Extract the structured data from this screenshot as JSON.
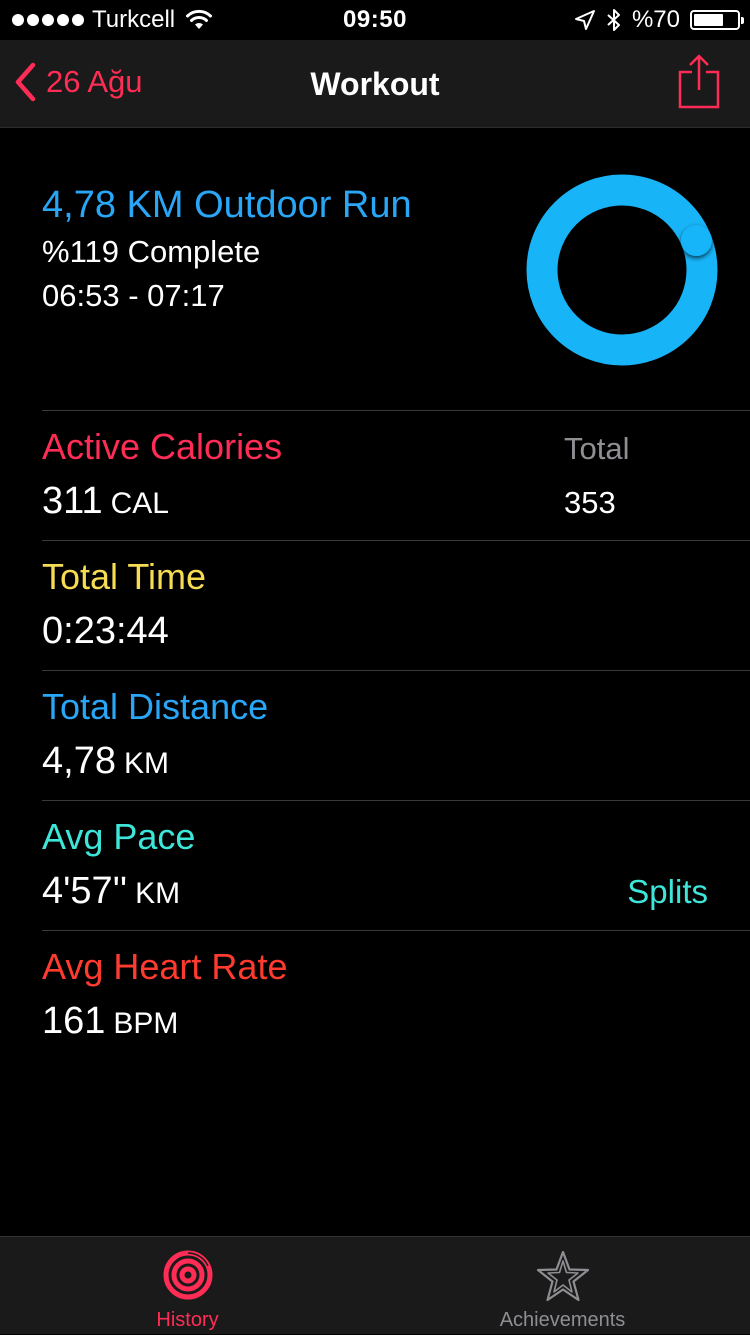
{
  "status_bar": {
    "carrier": "Turkcell",
    "time": "09:50",
    "battery": "%70",
    "battery_level": 0.7
  },
  "nav": {
    "back_label": "26 Ağu",
    "title": "Workout",
    "share_icon": "share-icon"
  },
  "workout": {
    "title": "4,78 KM Outdoor Run",
    "complete": "%119 Complete",
    "time_range": "06:53 - 07:17",
    "progress_fraction": 1.19,
    "ring_color": "#18b4f8"
  },
  "metrics": {
    "active_calories": {
      "label": "Active Calories",
      "value": "311",
      "unit": "CAL",
      "color": "#ff2d55"
    },
    "total_calories": {
      "label": "Total",
      "value": "353"
    },
    "total_time": {
      "label": "Total Time",
      "value": "0:23:44",
      "color": "#f5dc52"
    },
    "total_distance": {
      "label": "Total Distance",
      "value": "4,78",
      "unit": "KM",
      "color": "#2aa6f7"
    },
    "avg_pace": {
      "label": "Avg Pace",
      "value": "4'57''",
      "unit": "KM",
      "color": "#3ee6da",
      "splits_label": "Splits"
    },
    "avg_heart_rate": {
      "label": "Avg Heart Rate",
      "value": "161",
      "unit": "BPM",
      "color": "#ff3b30"
    }
  },
  "tabs": [
    {
      "label": "History",
      "icon": "activity-rings-icon",
      "active": true,
      "color": "#ff2d55"
    },
    {
      "label": "Achievements",
      "icon": "star-badge-icon",
      "active": false,
      "color": "#8e8e93"
    }
  ],
  "colors": {
    "accent": "#ff2d55",
    "background": "#000000",
    "bar": "#1a1a1a",
    "separator": "#3a3a3a"
  }
}
